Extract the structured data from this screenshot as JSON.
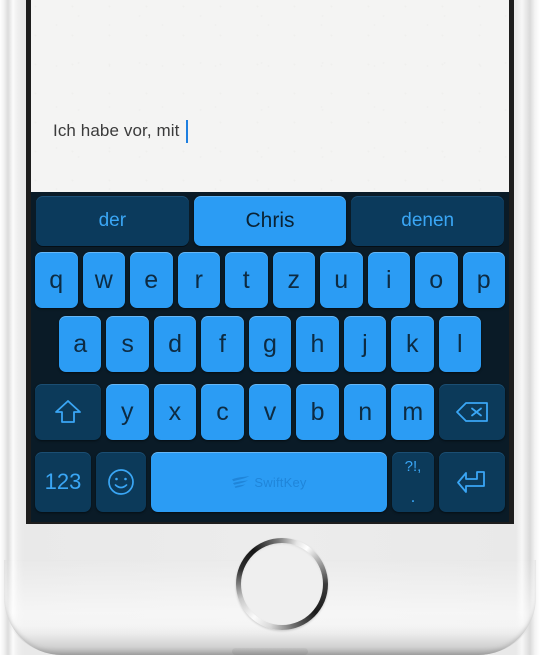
{
  "device": {
    "type": "smartphone",
    "home_button": "home-button",
    "frame_color": "#ececec"
  },
  "compose": {
    "text": "Ich habe vor, mit ",
    "caret_color": "#1e7fe0",
    "background": "#f4f4f3"
  },
  "keyboard": {
    "app": "SwiftKey",
    "layout": "QWERTZ",
    "language": "German",
    "background": "#0a1b27",
    "letter_key_color": "#2b9cf4",
    "function_key_color": "#0c3a5a",
    "accent_color": "#3aa6f5",
    "suggestions": [
      {
        "label": "der",
        "highlighted": false
      },
      {
        "label": "Chris",
        "highlighted": true
      },
      {
        "label": "denen",
        "highlighted": false
      }
    ],
    "row1": [
      "q",
      "w",
      "e",
      "r",
      "t",
      "z",
      "u",
      "i",
      "o",
      "p"
    ],
    "row2": [
      "a",
      "s",
      "d",
      "f",
      "g",
      "h",
      "j",
      "k",
      "l"
    ],
    "row3_letters": [
      "y",
      "x",
      "c",
      "v",
      "b",
      "n",
      "m"
    ],
    "shift_key": "shift-icon",
    "backspace_key": "backspace-icon",
    "numeric_key": "123",
    "emoji_key": "emoji-smiley-icon",
    "space_key_brand": "SwiftKey",
    "punctuation_key": {
      "top": "?!,",
      "bottom": "."
    },
    "enter_key": "enter-icon"
  }
}
